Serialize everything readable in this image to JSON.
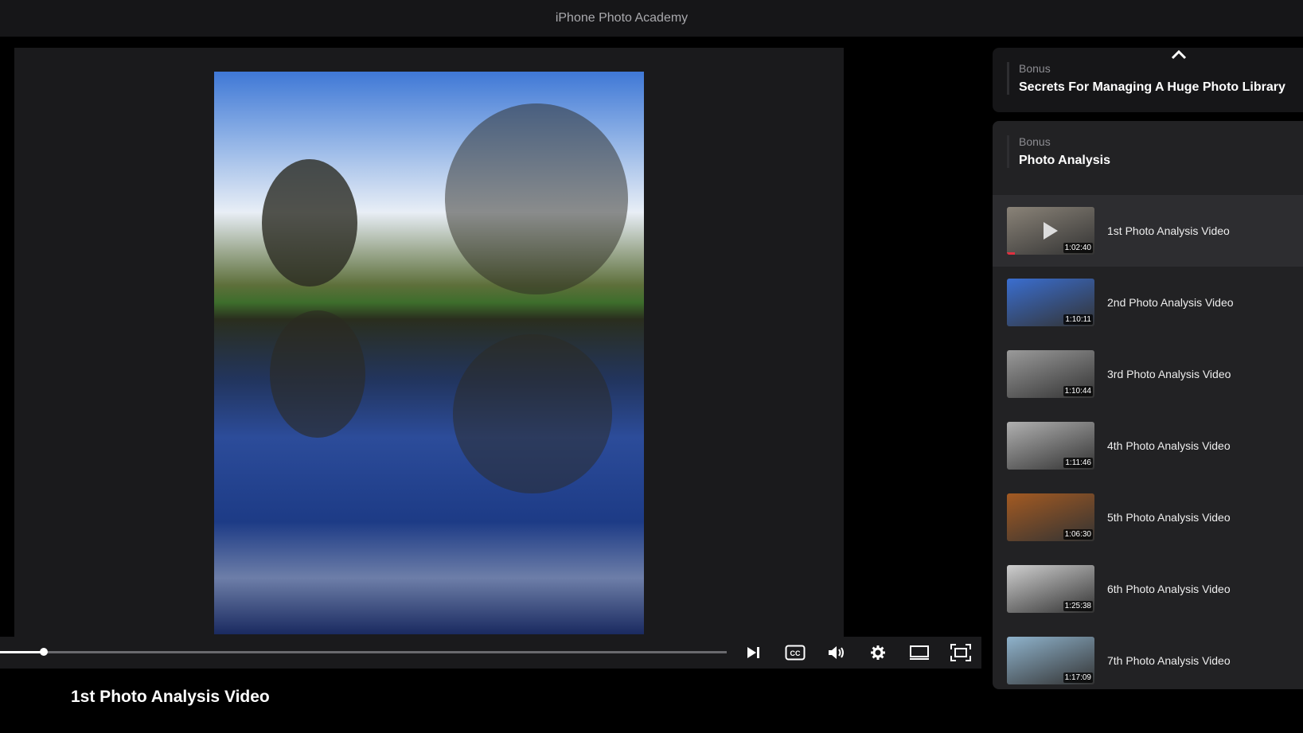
{
  "app": {
    "title": "iPhone Photo Academy"
  },
  "player": {
    "progress_percent": 6,
    "controls": [
      "next-icon",
      "cc-icon",
      "volume-icon",
      "settings-icon",
      "theater-icon",
      "fullscreen-icon"
    ]
  },
  "video_title": "1st Photo Analysis Video",
  "sidebar": {
    "sections": [
      {
        "kicker": "Bonus",
        "title": "Secrets For Managing A Huge Photo Library"
      },
      {
        "kicker": "Bonus",
        "title": "Photo Analysis"
      }
    ],
    "videos": [
      {
        "label": "1st Photo Analysis Video",
        "duration": "1:02:40",
        "active": true,
        "thumb": "#8a8378"
      },
      {
        "label": "2nd Photo Analysis Video",
        "duration": "1:10:11",
        "thumb": "#3a6ed0"
      },
      {
        "label": "3rd Photo Analysis Video",
        "duration": "1:10:44",
        "thumb": "#9a9a9a"
      },
      {
        "label": "4th Photo Analysis Video",
        "duration": "1:11:46",
        "thumb": "#b0b0b0"
      },
      {
        "label": "5th Photo Analysis Video",
        "duration": "1:06:30",
        "thumb": "#a35a22"
      },
      {
        "label": "6th Photo Analysis Video",
        "duration": "1:25:38",
        "thumb": "#cfcfcf"
      },
      {
        "label": "7th Photo Analysis Video",
        "duration": "1:17:09",
        "thumb": "#8fb3cc"
      }
    ]
  }
}
